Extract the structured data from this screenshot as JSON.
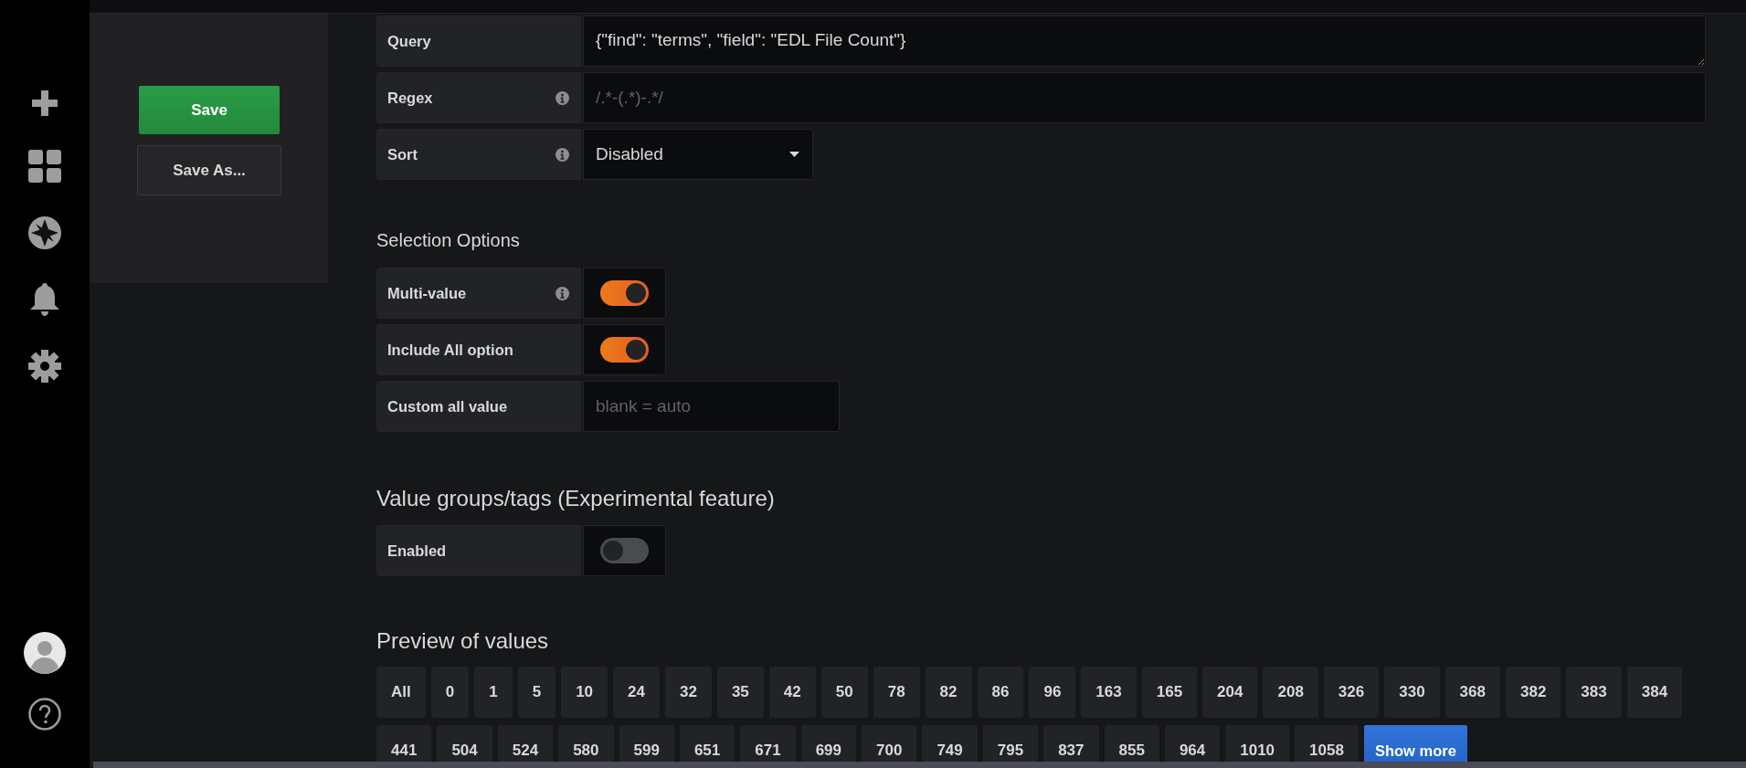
{
  "actions": {
    "buttons": [
      {
        "label": "Save",
        "kind": "primary"
      },
      {
        "label": "Save As...",
        "kind": "secondary"
      }
    ]
  },
  "query_options": [
    {
      "kind": "textarea",
      "label": "Query",
      "info": false,
      "value": "{\"find\": \"terms\", \"field\": \"EDL File Count\"}"
    },
    {
      "kind": "input",
      "label": "Regex",
      "info": true,
      "placeholder": "/.*-(.*)-.*/"
    },
    {
      "kind": "select",
      "label": "Sort",
      "info": true,
      "value": "Disabled"
    }
  ],
  "selection_options": {
    "title": "Selection Options",
    "rows": [
      {
        "kind": "switch",
        "label": "Multi-value",
        "info": true,
        "on": true
      },
      {
        "kind": "switch",
        "label": "Include All option",
        "info": false,
        "on": true
      },
      {
        "kind": "input",
        "label": "Custom all value",
        "info": false,
        "placeholder": "blank = auto"
      }
    ]
  },
  "value_groups": {
    "title": "Value groups/tags (Experimental feature)",
    "rows": [
      {
        "kind": "switch",
        "label": "Enabled",
        "info": false,
        "on": false
      }
    ]
  },
  "preview": {
    "title": "Preview of values",
    "values": [
      "All",
      "0",
      "1",
      "5",
      "10",
      "24",
      "32",
      "35",
      "42",
      "50",
      "78",
      "82",
      "86",
      "96",
      "163",
      "165",
      "204",
      "208",
      "326",
      "330",
      "368",
      "382",
      "383",
      "384",
      "441",
      "504",
      "524",
      "580",
      "599",
      "651",
      "671",
      "699",
      "700",
      "749",
      "795",
      "837",
      "855",
      "964",
      "1010",
      "1058"
    ],
    "show_more": "Show more"
  }
}
